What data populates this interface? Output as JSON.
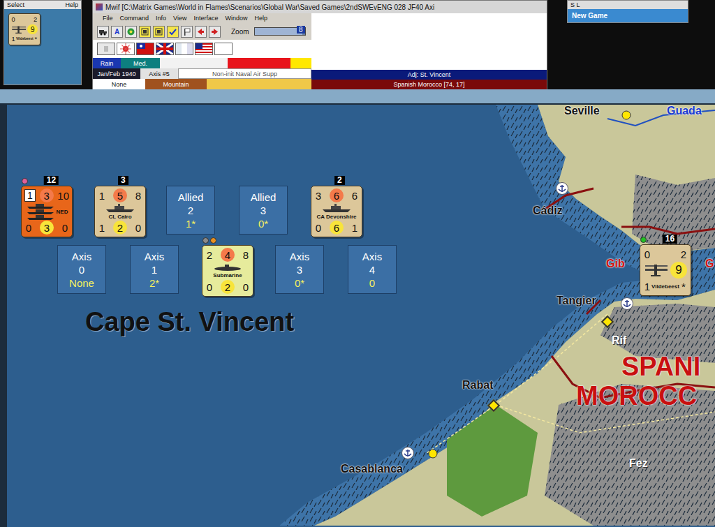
{
  "select_window": {
    "menu": [
      "Select",
      "Help"
    ]
  },
  "main_window": {
    "title": "Mwif [C:\\Matrix Games\\World in Flames\\Scenarios\\Global War\\Saved Games\\2ndSWEvENG 028 JF40 Axi",
    "menu": [
      "File",
      "Command",
      "Info",
      "View",
      "Interface",
      "Window",
      "Help"
    ],
    "toolbar": [
      {
        "kind": "truck",
        "selected": false
      },
      {
        "kind": "letter",
        "label": "A",
        "selected": false
      },
      {
        "kind": "globe",
        "selected": false
      },
      {
        "kind": "grid",
        "selected": true
      },
      {
        "kind": "grid",
        "selected": true
      },
      {
        "kind": "check",
        "selected": true
      },
      {
        "kind": "flag",
        "selected": false
      },
      {
        "kind": "back",
        "selected": false
      },
      {
        "kind": "forward",
        "selected": false
      }
    ],
    "zoom": {
      "label": "Zoom",
      "value": "8",
      "level": 0.95
    },
    "info": {
      "weather": "Rain",
      "climate": "Med.",
      "turn": "Jan/Feb 1940",
      "impulse": "Axis #5",
      "phase": "Non-init Naval Air Supp",
      "control": "None",
      "terrain": "Mountain",
      "adjacent": "Adj: St. Vincent",
      "hex": "Spanish Morocco [74, 17]"
    }
  },
  "side_window": {
    "title": "S L",
    "items": [
      "New Game"
    ]
  },
  "map": {
    "sea_area": "Cape St. Vincent",
    "allied": [
      {
        "kind": "fleet",
        "stack": "12",
        "dots": [
          "#e0609a"
        ],
        "color": "#e8661a",
        "top": [
          "1",
          "3",
          "10"
        ],
        "name": "NED",
        "bottom": [
          "0",
          "3",
          "0"
        ]
      },
      {
        "kind": "ship",
        "stack": "3",
        "dots": [],
        "color": "#dcc79a",
        "top": [
          "1",
          "5",
          "8"
        ],
        "name": "CL Cairo",
        "bottom": [
          "1",
          "2",
          "0"
        ]
      },
      {
        "kind": "box",
        "title": "Allied",
        "number": "2",
        "value": "1*"
      },
      {
        "kind": "box",
        "title": "Allied",
        "number": "3",
        "value": "0*"
      },
      {
        "kind": "ship",
        "stack": "2",
        "dots": [],
        "color": "#dcc79a",
        "top": [
          "3",
          "6",
          "6"
        ],
        "name": "CA Devonshire",
        "bottom": [
          "0",
          "6",
          "1"
        ]
      }
    ],
    "axis": [
      {
        "kind": "box",
        "title": "Axis",
        "number": "0",
        "value": "None"
      },
      {
        "kind": "box",
        "title": "Axis",
        "number": "1",
        "value": "2*"
      },
      {
        "kind": "sub",
        "stack": "",
        "dots": [
          "#8a8a8a",
          "#e89020"
        ],
        "color": "#e6eb9c",
        "top": [
          "2",
          "4",
          "8"
        ],
        "name": "Submarine",
        "bottom": [
          "0",
          "2",
          "0"
        ]
      },
      {
        "kind": "box",
        "title": "Axis",
        "number": "3",
        "value": "0*"
      },
      {
        "kind": "box",
        "title": "Axis",
        "number": "4",
        "value": "0"
      }
    ],
    "air_unit": {
      "stack": "16",
      "dots": [
        "#22c022"
      ],
      "color": "#dcc79a",
      "top": [
        "0",
        "2"
      ],
      "value": "9",
      "bottom": "1",
      "name": "Vildebeest",
      "mark": "*"
    },
    "places": [
      {
        "name": "Seville",
        "kind": "city",
        "color": "#111111"
      },
      {
        "name": "Guada",
        "kind": "label",
        "color": "#1a3ad0"
      },
      {
        "name": "Cádiz",
        "kind": "port",
        "color": "#111111"
      },
      {
        "name": "Gib",
        "kind": "label",
        "color": "#d01010"
      },
      {
        "name": "G",
        "kind": "label",
        "color": "#d01010"
      },
      {
        "name": "Tangier",
        "kind": "capitalport",
        "color": "#111111"
      },
      {
        "name": "Rif",
        "kind": "label",
        "color": "#ffffff"
      },
      {
        "name": "Rabat",
        "kind": "capital",
        "color": "#111111"
      },
      {
        "name": "Casablanca",
        "kind": "cityport",
        "color": "#111111"
      },
      {
        "name": "Fez",
        "kind": "label",
        "color": "#ffffff"
      }
    ],
    "region": [
      "SPANI",
      "MOROCC"
    ]
  }
}
